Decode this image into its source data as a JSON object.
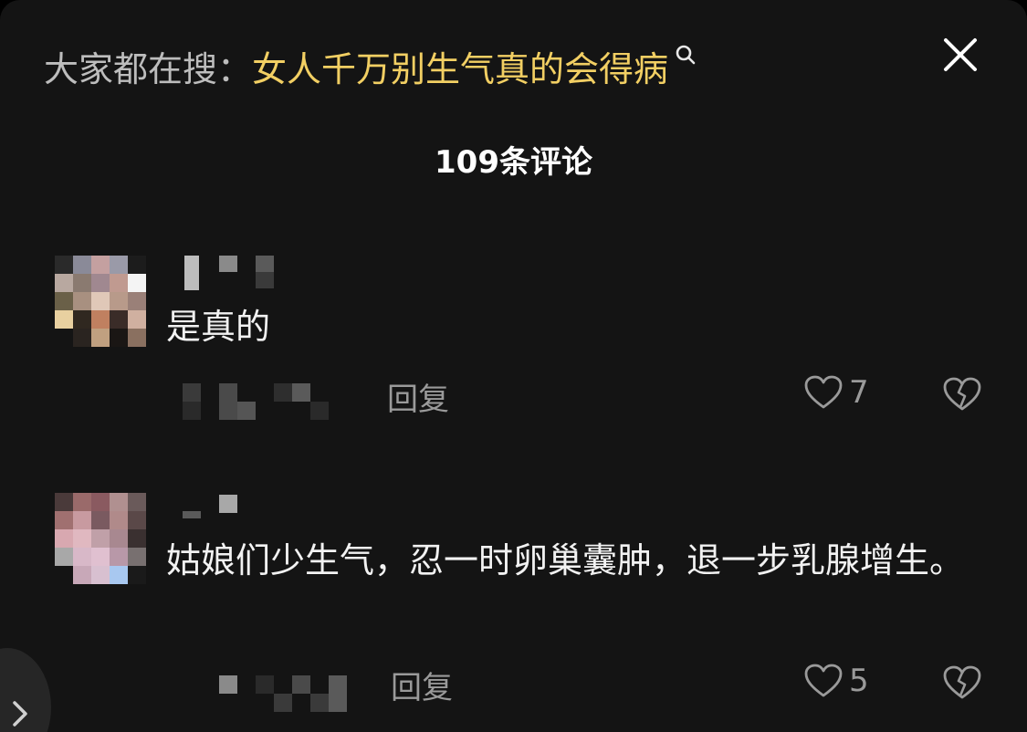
{
  "header": {
    "search_prefix": "大家都在搜：",
    "search_term": "女人千万别生气真的会得病",
    "search_icon": "search-icon",
    "close_icon": "close-icon"
  },
  "comment_count": "109条评论",
  "comments": [
    {
      "text": "是真的",
      "reply_label": "回复",
      "likes": "7",
      "like_icon": "heart-outline-icon",
      "dislike_icon": "broken-heart-icon"
    },
    {
      "text": "姑娘们少生气，忍一时卵巢囊肿，退一步乳腺增生。",
      "reply_label": "回复",
      "likes": "5",
      "like_icon": "heart-outline-icon",
      "dislike_icon": "broken-heart-icon"
    }
  ],
  "colors": {
    "background": "#141414",
    "search_term": "#f2cf63",
    "primary_text": "#f2f2f2",
    "secondary_text": "#9a9a9a"
  }
}
